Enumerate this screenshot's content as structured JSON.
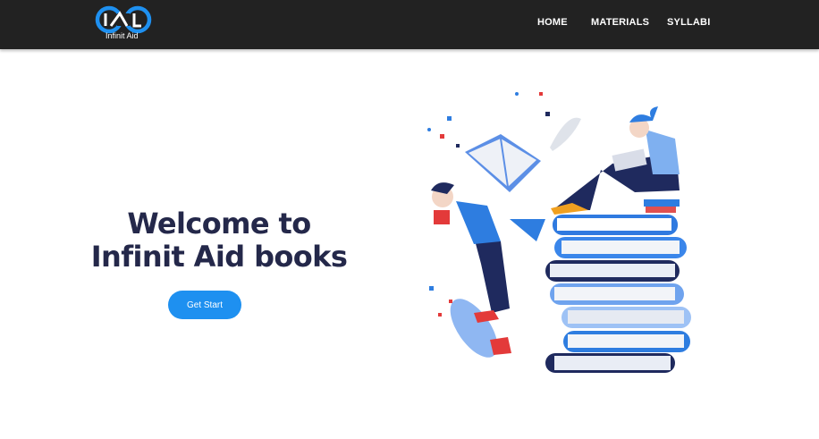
{
  "brand": {
    "name": "Infinit Aid",
    "logo_icon": "infinity-ai-logo-icon"
  },
  "nav": {
    "items": [
      {
        "label": "HOME"
      },
      {
        "label": "MATERIALS"
      },
      {
        "label": "SYLLABI"
      }
    ]
  },
  "hero": {
    "title_line1": "Welcome to",
    "title_line2": "Infinit Aid books",
    "cta_label": "Get Start"
  },
  "colors": {
    "navbar": "#222222",
    "accent": "#1e90f0",
    "heading": "#24284a"
  }
}
